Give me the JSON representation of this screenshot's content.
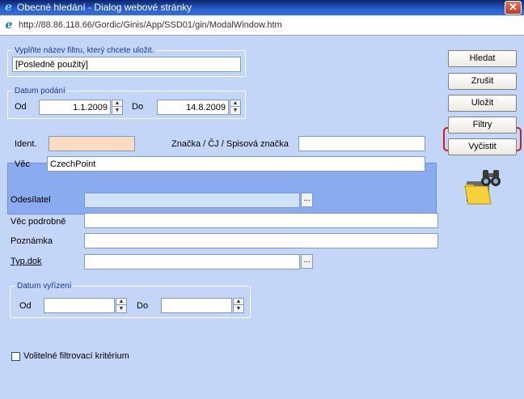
{
  "window": {
    "title": "Obecné hledání - Dialog webové stránky",
    "close_glyph": "✕"
  },
  "address": {
    "url": "http://88.86.118.66/Gordic/Ginis/App/SSD01/gin/ModalWindow.htm"
  },
  "filter_name": {
    "legend": "Vyplňte název filtru, který chcete uložit.",
    "value": "[Posledně použitý]"
  },
  "datum_podani": {
    "legend": "Datum podání",
    "od_label": "Od",
    "od_value": "1.1.2009",
    "do_label": "Do",
    "do_value": "14.8.2009"
  },
  "ident_panel": {
    "ident_label": "Ident.",
    "ident_value": "",
    "znacka_label": "Značka  / ČJ / Spisová značka",
    "znacka_value": "",
    "vec_label": "Věc",
    "vec_value": "CzechPoint"
  },
  "fields": {
    "odesilatel_label": "Odesílatel",
    "odesilatel_value": "",
    "vec_podrobne_label": "Věc podrobně",
    "vec_podrobne_value": "",
    "poznamka_label": "Poznámka",
    "poznamka_value": "",
    "typ_dok_label": "Typ.dok",
    "typ_dok_value": "",
    "ellipsis": "..."
  },
  "datum_vyrizeni": {
    "legend": "Datum vyřízení",
    "od_label": "Od",
    "od_value": "",
    "do_label": "Do",
    "do_value": ""
  },
  "volitelne": {
    "label": "Volitelné filtrovací kritérium",
    "checked": false
  },
  "buttons": {
    "hledat": "Hledat",
    "zrusit": "Zrušit",
    "ulozit": "Uložit",
    "filtry": "Filtry",
    "vycistit": "Vyčistit"
  },
  "icons": {
    "ie": "internet-explorer-icon",
    "folder_search": "folder-binoculars-icon"
  },
  "colors": {
    "dialog_bg": "#c4d6f8",
    "panel_bg": "#8aabf0",
    "ident_bg": "#fbdcc0",
    "odesilatel_bg": "#cfe2f7",
    "highlight": "#d31b1b"
  }
}
